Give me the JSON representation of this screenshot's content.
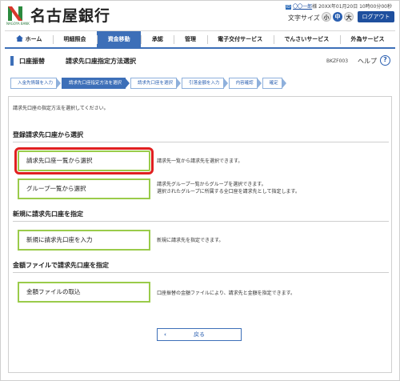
{
  "header": {
    "bank_name": "名古屋銀行",
    "logo_sub": "NAGOYA BANK",
    "user_badge": "ID",
    "user_name": "〇〇一郎",
    "user_suffix": "様",
    "last_login": "20XX年01月20日 10時00分00秒",
    "font_size_label": "文字サイズ",
    "font_small": "小",
    "font_medium": "中",
    "font_large": "大",
    "logout": "ログアウト"
  },
  "nav": {
    "items": [
      "ホーム",
      "明細照会",
      "資金移動",
      "承認",
      "管理",
      "電子交付サービス",
      "でんさいサービス",
      "外為サービス"
    ],
    "active_index": 2
  },
  "page": {
    "title_main": "口座振替",
    "title_sub": "請求先口座指定方法選択",
    "screen_id": "BKZF003",
    "help": "ヘルプ",
    "help_icon": "?"
  },
  "steps": {
    "items": [
      "入金先情報を入力",
      "請求先口座指定方法を選択",
      "請求先口座を選択",
      "引落金額を入力",
      "内容確認",
      "確定"
    ],
    "active_index": 1
  },
  "content": {
    "instruction": "請求先口座の指定方法を選択してください。",
    "section1_title": "登録請求先口座から選択",
    "btn_list": "請求先口座一覧から選択",
    "desc_list": "請求先一覧から請求先を選択できます。",
    "btn_group": "グループ一覧から選択",
    "desc_group_1": "請求先グループ一覧からグループを選択できます。",
    "desc_group_2": "選択されたグループに所属する全口座を請求先として指定します。",
    "section2_title": "新規に請求先口座を指定",
    "btn_new": "新規に請求先口座を入力",
    "desc_new": "新規に請求先を指定できます。",
    "section3_title": "金額ファイルで請求先口座を指定",
    "btn_file": "金額ファイルの取込",
    "desc_file": "口座振替の金額ファイルにより、請求先と金額を指定できます。",
    "back": "戻る"
  },
  "colors": {
    "accent": "#3d6fb8",
    "highlight": "#e02020",
    "button_border": "#9acb4a"
  }
}
